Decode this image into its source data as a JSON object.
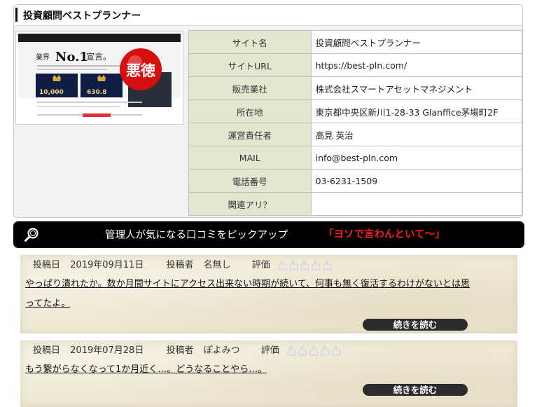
{
  "card": {
    "title": "投資顧問ベストプランナー"
  },
  "thumbnail": {
    "headline": "業界No.1宣言。",
    "stat1": "10,000",
    "stat2": "630.8",
    "stamp": "悪徳",
    "stamp_color": "#d60e0e"
  },
  "info_rows": [
    {
      "key": "サイト名",
      "value": "投資顧問ベストプランナー"
    },
    {
      "key": "サイトURL",
      "value": "https://best-pln.com/"
    },
    {
      "key": "販売業社",
      "value": "株式会社スマートアセットマネジメント"
    },
    {
      "key": "所在地",
      "value": "東京都中央区新川1-28-33 Glanffice茅場町2F"
    },
    {
      "key": "運営責任者",
      "value": "高見 英治"
    },
    {
      "key": "MAIL",
      "value": "info@best-pln.com"
    },
    {
      "key": "電話番号",
      "value": "03-6231-1509"
    },
    {
      "key": "関連アリ？",
      "value": ""
    }
  ],
  "banner": {
    "text": "管理人が気になる口コミをピックアップ",
    "highlight": "「ヨソで言わんといて～」",
    "highlight_color": "#ff1b1b"
  },
  "reviews": [
    {
      "date_label": "投稿日",
      "date": "2019年09月11日",
      "author_label": "投稿者",
      "author": "名無し",
      "rating_label": "評価",
      "rating": 0,
      "line1": "やっぱり潰れたか。数か月間サイトにアクセス出来ない時期が続いて、何事も無く復活するわけがないとは思",
      "line2": "ってたよ。",
      "read_more": "続きを読む"
    },
    {
      "date_label": "投稿日",
      "date": "2019年07月28日",
      "author_label": "投稿者",
      "author": "ぽよみつ",
      "rating_label": "評価",
      "rating": 0,
      "line1": "もう繋がらなくなって1か月近く…。どうなることやら…。",
      "line2": "",
      "read_more": "続きを読む"
    }
  ]
}
